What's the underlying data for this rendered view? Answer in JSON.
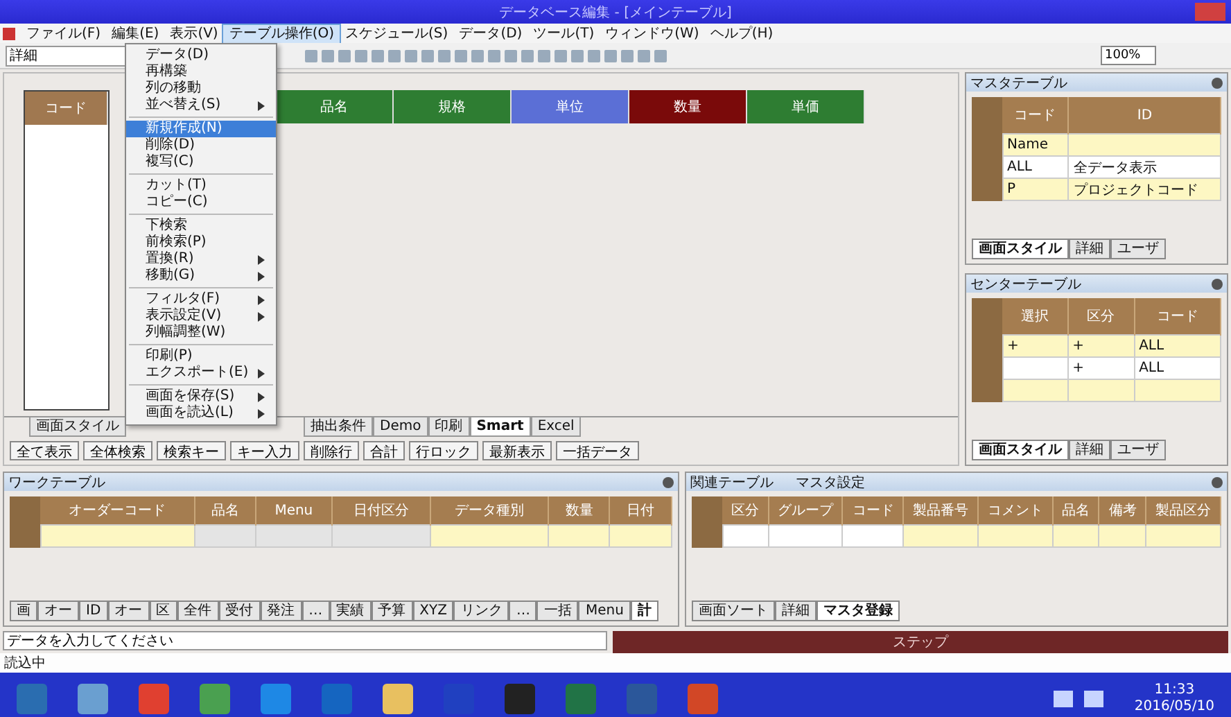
{
  "window": {
    "title": "データベース編集 - [メインテーブル]"
  },
  "menu_bar": [
    {
      "label": "ファイル(F)",
      "selected": false
    },
    {
      "label": "編集(E)",
      "selected": false
    },
    {
      "label": "表示(V)",
      "selected": false
    },
    {
      "label": "テーブル操作(O)",
      "selected": true
    },
    {
      "label": "スケジュール(S)",
      "selected": false
    },
    {
      "label": "データ(D)",
      "selected": false
    },
    {
      "label": "ツール(T)",
      "selected": false
    },
    {
      "label": "ウィンドウ(W)",
      "selected": false
    },
    {
      "label": "ヘルプ(H)",
      "selected": false
    }
  ],
  "toolbar": {
    "field_value": "詳細",
    "zoom_value": "100%"
  },
  "dropdown_menu": [
    {
      "kind": "item",
      "label": "データ(D)",
      "submenu": false,
      "selected": false
    },
    {
      "kind": "item",
      "label": "再構築",
      "submenu": false,
      "selected": false
    },
    {
      "kind": "item",
      "label": "列の移動",
      "submenu": false,
      "selected": false
    },
    {
      "kind": "item",
      "label": "並べ替え(S)",
      "submenu": true,
      "selected": false
    },
    {
      "kind": "separator"
    },
    {
      "kind": "item",
      "label": "新規作成(N)",
      "submenu": false,
      "selected": true
    },
    {
      "kind": "item",
      "label": "削除(D)",
      "submenu": false,
      "selected": false
    },
    {
      "kind": "item",
      "label": "複写(C)",
      "submenu": false,
      "selected": false
    },
    {
      "kind": "separator"
    },
    {
      "kind": "item",
      "label": "カット(T)",
      "submenu": false,
      "selected": false
    },
    {
      "kind": "item",
      "label": "コピー(C)",
      "submenu": false,
      "selected": false
    },
    {
      "kind": "separator"
    },
    {
      "kind": "item",
      "label": "下検索",
      "submenu": false,
      "selected": false
    },
    {
      "kind": "item",
      "label": "前検索(P)",
      "submenu": false,
      "selected": false
    },
    {
      "kind": "item",
      "label": "置換(R)",
      "submenu": true,
      "selected": false
    },
    {
      "kind": "item",
      "label": "移動(G)",
      "submenu": true,
      "selected": false
    },
    {
      "kind": "separator"
    },
    {
      "kind": "item",
      "label": "フィルタ(F)",
      "submenu": true,
      "selected": false
    },
    {
      "kind": "item",
      "label": "表示設定(V)",
      "submenu": true,
      "selected": false
    },
    {
      "kind": "item",
      "label": "列幅調整(W)",
      "submenu": false,
      "selected": false
    },
    {
      "kind": "separator"
    },
    {
      "kind": "item",
      "label": "印刷(P)",
      "submenu": false,
      "selected": false
    },
    {
      "kind": "item",
      "label": "エクスポート(E)",
      "submenu": true,
      "selected": false
    },
    {
      "kind": "separator"
    },
    {
      "kind": "item",
      "label": "画面を保存(S)",
      "submenu": true,
      "selected": false
    },
    {
      "kind": "item",
      "label": "画面を読込(L)",
      "submenu": true,
      "selected": false
    }
  ],
  "main_table": {
    "columns": [
      {
        "label": "コード",
        "color": "#a07850"
      },
      {
        "label": "品名",
        "color": "#2e7d32"
      },
      {
        "label": "規格",
        "color": "#2e7d32"
      },
      {
        "label": "単位",
        "color": "#5b6fd6"
      },
      {
        "label": "数量",
        "color": "#7a0a0a"
      },
      {
        "label": "単価",
        "color": "#2e7d32"
      }
    ]
  },
  "sheet_tabs": [
    {
      "label": "画面スタイル",
      "selected": false
    },
    {
      "label": "抽出条件",
      "selected": false
    },
    {
      "label": "Demo",
      "selected": false
    },
    {
      "label": "印刷",
      "selected": false
    },
    {
      "label": "Smart",
      "selected": true
    },
    {
      "label": "Excel",
      "selected": false
    }
  ],
  "filter_buttons": [
    "全て表示",
    "全体検索",
    "検索キー",
    "キー入力",
    "削除行",
    "合計",
    "行ロック",
    "最新表示",
    "一括データ"
  ],
  "master_panel": {
    "title": "マスタテーブル",
    "columns": [
      "コード",
      "ID"
    ],
    "rows": [
      [
        "Name",
        ""
      ],
      [
        "ALL",
        "全データ表示"
      ],
      [
        "P",
        "プロジェクトコード"
      ]
    ],
    "tabs": [
      {
        "label": "画面スタイル",
        "selected": true
      },
      {
        "label": "詳細",
        "selected": false
      },
      {
        "label": "ユーザ",
        "selected": false
      }
    ]
  },
  "center_panel": {
    "title": "センターテーブル",
    "columns": [
      "選択",
      "区分",
      "コード"
    ],
    "rows": [
      [
        "+",
        "+",
        "ALL"
      ],
      [
        "",
        "+",
        "ALL"
      ],
      [
        "",
        "",
        ""
      ]
    ],
    "tabs": [
      {
        "label": "画面スタイル",
        "selected": true
      },
      {
        "label": "詳細",
        "selected": false
      },
      {
        "label": "ユーザ",
        "selected": false
      }
    ]
  },
  "work_panel": {
    "title": "ワークテーブル",
    "columns": [
      "オーダーコード",
      "品名",
      "Menu",
      "日付区分",
      "データ種別",
      "数量",
      "日付"
    ],
    "tabs": [
      {
        "label": "画",
        "selected": false
      },
      {
        "label": "オー",
        "selected": false
      },
      {
        "label": "ID",
        "selected": false
      },
      {
        "label": "オー",
        "selected": false
      },
      {
        "label": "区",
        "selected": false
      },
      {
        "label": "全件",
        "selected": false
      },
      {
        "label": "受付",
        "selected": false
      },
      {
        "label": "発注",
        "selected": false
      },
      {
        "label": "…",
        "selected": false
      },
      {
        "label": "実績",
        "selected": false
      },
      {
        "label": "予算",
        "selected": false
      },
      {
        "label": "XYZ",
        "selected": false
      },
      {
        "label": "リンク",
        "selected": false
      },
      {
        "label": "…",
        "selected": false
      },
      {
        "label": "一括",
        "selected": false
      },
      {
        "label": "Menu",
        "selected": false
      },
      {
        "label": "計",
        "selected": true
      }
    ]
  },
  "related_panel": {
    "title": "関連テーブル",
    "subtitle": "マスタ設定",
    "columns": [
      "区分",
      "グループ",
      "コード",
      "製品番号",
      "コメント",
      "品名",
      "備考",
      "製品区分"
    ],
    "tabs": [
      {
        "label": "画面ソート",
        "selected": false
      },
      {
        "label": "詳細",
        "selected": false
      },
      {
        "label": "マスタ登録",
        "selected": true
      }
    ]
  },
  "status": {
    "input": "データを入力してください",
    "bar_text": "ステップ",
    "message": "読込中"
  },
  "taskbar": {
    "time": "11:33",
    "date": "2016/05/10"
  }
}
